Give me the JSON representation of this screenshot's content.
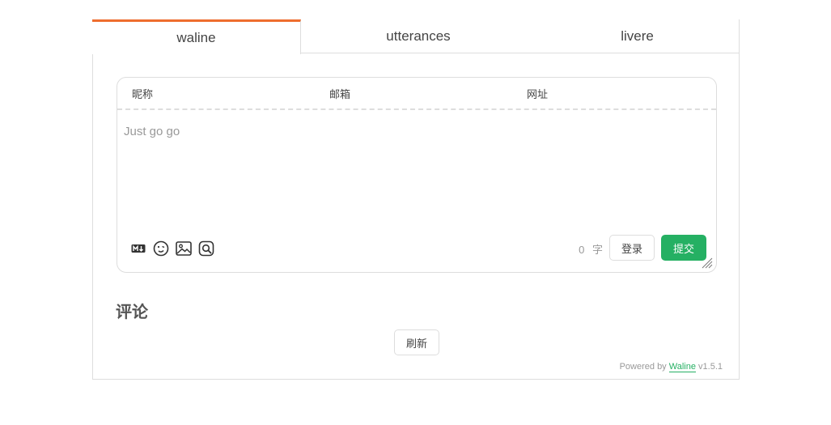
{
  "tabs": [
    {
      "label": "waline"
    },
    {
      "label": "utterances"
    },
    {
      "label": "livere"
    }
  ],
  "editor": {
    "nick_label": "昵称",
    "mail_label": "邮箱",
    "link_label": "网址",
    "placeholder": "Just go go",
    "word_count": "0",
    "word_unit": "字",
    "login_label": "登录",
    "submit_label": "提交",
    "icons": [
      "markdown-icon",
      "emoji-icon",
      "image-icon",
      "preview-icon"
    ]
  },
  "comments": {
    "title": "评论",
    "refresh_label": "刷新"
  },
  "footer": {
    "powered_by": "Powered by",
    "brand": "Waline",
    "version": "v1.5.1"
  },
  "colors": {
    "accent_tab": "#ee6d2e",
    "submit_bg": "#25b063",
    "border": "#dddddd"
  }
}
